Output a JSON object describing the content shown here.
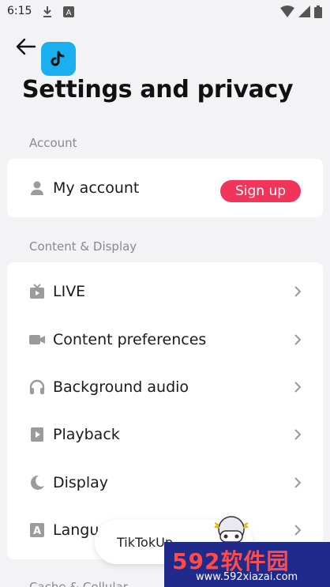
{
  "status_bar": {
    "time": "6:15"
  },
  "header": {
    "title": "Settings and privacy"
  },
  "account_section": {
    "label": "Account",
    "my_account": {
      "label": "My account",
      "signup_label": "Sign up"
    }
  },
  "content_section": {
    "label": "Content & Display",
    "items": [
      {
        "label": "LIVE",
        "icon": "tv-icon"
      },
      {
        "label": "Content preferences",
        "icon": "video-camera-icon"
      },
      {
        "label": "Background audio",
        "icon": "headphones-icon"
      },
      {
        "label": "Playback",
        "icon": "play-icon"
      },
      {
        "label": "Display",
        "icon": "moon-icon"
      },
      {
        "label": "Language",
        "icon": "language-icon"
      }
    ]
  },
  "next_section_label": "Cache & Cellular",
  "toast": {
    "text": "TikTokUp"
  },
  "watermark": {
    "site": "592软件园",
    "url": "www.592xiazai.com"
  },
  "colors": {
    "accent": "#f2335a",
    "background": "#f3f3f5",
    "card": "#ffffff",
    "icon": "#9b9b9b"
  }
}
